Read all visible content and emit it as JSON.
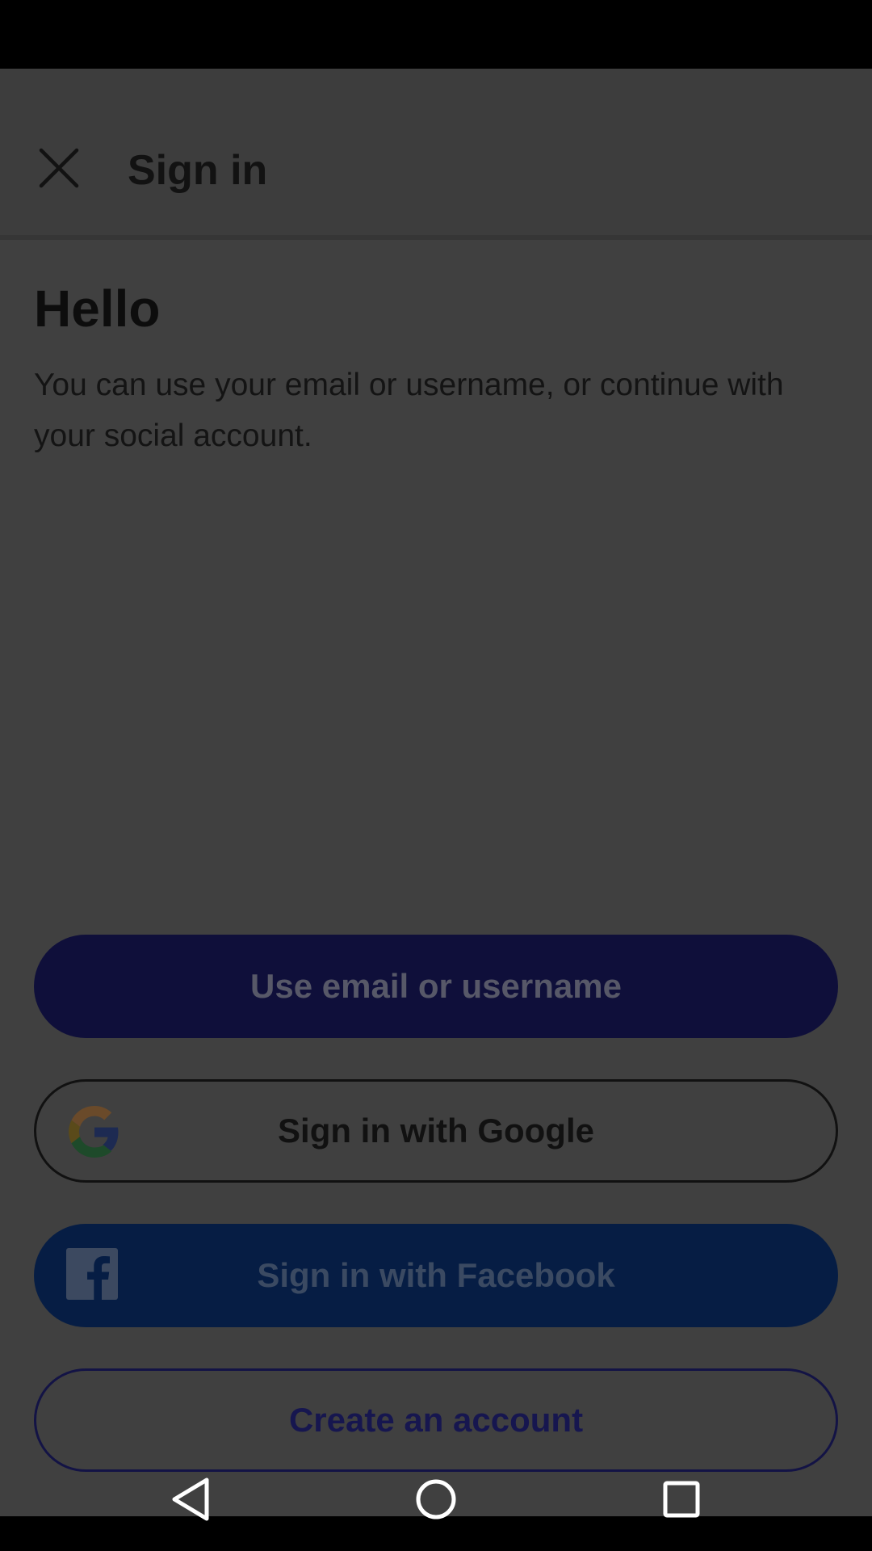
{
  "app_bar": {
    "title": "Sign in",
    "close_icon": "close-icon"
  },
  "content": {
    "heading": "Hello",
    "subtitle": "You can use your email or username, or continue with your social account."
  },
  "buttons": {
    "email": "Use email or username",
    "google": "Sign in with Google",
    "facebook": "Sign in with Facebook",
    "create": "Create an account"
  },
  "icons": {
    "google": "google-icon",
    "facebook": "facebook-icon"
  },
  "system_nav": {
    "back": "back-icon",
    "home": "home-icon",
    "recents": "recents-icon"
  },
  "colors": {
    "overlay_background": "#404040",
    "email_button": "#0f0f3a",
    "facebook_button": "#061d44",
    "create_border": "#131345"
  }
}
